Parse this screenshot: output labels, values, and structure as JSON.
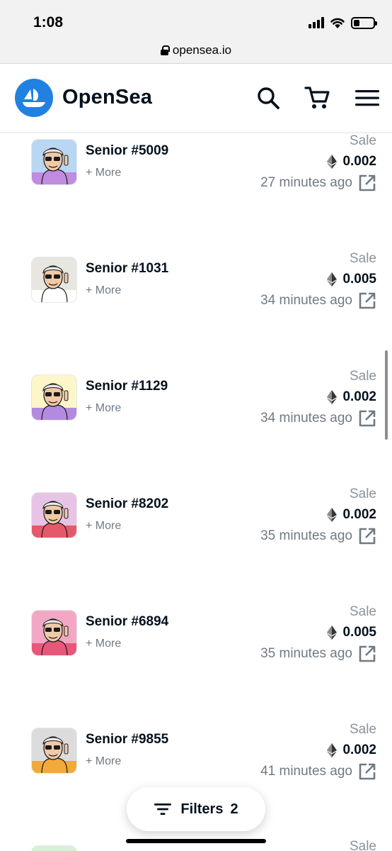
{
  "status_bar": {
    "time": "1:08"
  },
  "browser": {
    "url": "opensea.io"
  },
  "header": {
    "brand": "OpenSea",
    "icons": [
      "opensea-logo-icon",
      "search-icon",
      "cart-icon",
      "menu-icon"
    ]
  },
  "colors": {
    "brand_blue": "#2081e2",
    "text_dark": "#04111d",
    "text_muted": "#707a83"
  },
  "activity": [
    {
      "name": "Senior #5009",
      "more": "+ More",
      "event": "Sale",
      "price": "0.002",
      "time": "27 minutes ago",
      "bg": "#b9d7f2",
      "shirt": "#c08be0"
    },
    {
      "name": "Senior #1031",
      "more": "+ More",
      "event": "Sale",
      "price": "0.005",
      "time": "34 minutes ago",
      "bg": "#e8e6e1",
      "shirt": "#ffffff"
    },
    {
      "name": "Senior #1129",
      "more": "+ More",
      "event": "Sale",
      "price": "0.002",
      "time": "34 minutes ago",
      "bg": "#fdf6c9",
      "shirt": "#b48ae0"
    },
    {
      "name": "Senior #8202",
      "more": "+ More",
      "event": "Sale",
      "price": "0.002",
      "time": "35 minutes ago",
      "bg": "#e7c4e6",
      "shirt": "#e55a6b"
    },
    {
      "name": "Senior #6894",
      "more": "+ More",
      "event": "Sale",
      "price": "0.005",
      "time": "35 minutes ago",
      "bg": "#f2a8c4",
      "shirt": "#e8577a"
    },
    {
      "name": "Senior #9855",
      "more": "+ More",
      "event": "Sale",
      "price": "0.002",
      "time": "41 minutes ago",
      "bg": "#dcdcdc",
      "shirt": "#f2a93b"
    }
  ],
  "peek_row": {
    "event": "Sale"
  },
  "filters": {
    "label": "Filters",
    "count": "2"
  }
}
